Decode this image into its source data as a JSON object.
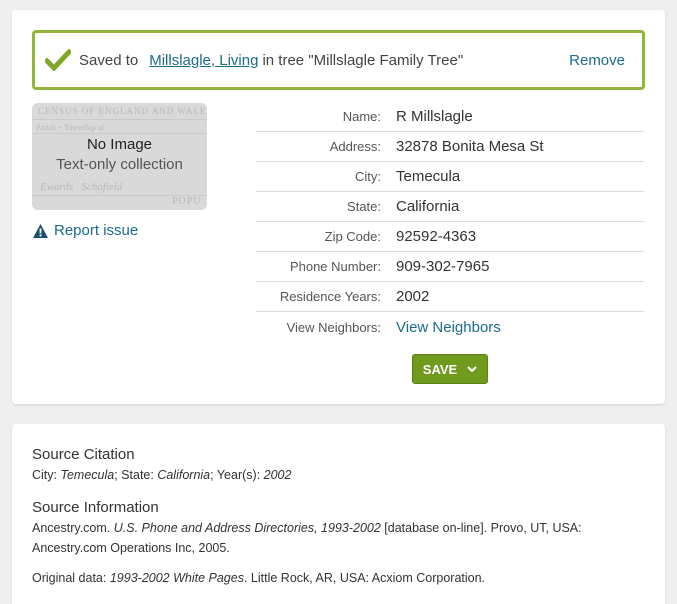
{
  "banner": {
    "saved_prefix": "Saved to",
    "person_link": "Millslagle, Living",
    "tree_text": "in tree \"Millslagle Family Tree\"",
    "remove_label": "Remove"
  },
  "image_panel": {
    "title": "No Image",
    "subtitle": "Text-only collection"
  },
  "report_label": "Report issue",
  "fields": [
    {
      "label": "Name:",
      "value": "R Millslagle"
    },
    {
      "label": "Address:",
      "value": "32878 Bonita Mesa St"
    },
    {
      "label": "City:",
      "value": "Temecula"
    },
    {
      "label": "State:",
      "value": "California"
    },
    {
      "label": "Zip Code:",
      "value": "92592-4363"
    },
    {
      "label": "Phone Number:",
      "value": "909-302-7965"
    },
    {
      "label": "Residence Years:",
      "value": "2002"
    },
    {
      "label": "View Neighbors:",
      "value": "View Neighbors"
    }
  ],
  "save_button": "SAVE",
  "source_citation": {
    "heading": "Source Citation",
    "city_label": "City:",
    "city": "Temecula",
    "state_label": "; State:",
    "state": "California",
    "years_label": "; Year(s):",
    "years": "2002"
  },
  "source_info": {
    "heading": "Source Information",
    "publisher": "Ancestry.com.",
    "db_title": "U.S. Phone and Address Directories, 1993-2002",
    "db_rest": "[database on-line]. Provo, UT, USA:",
    "line2": "Ancestry.com Operations Inc, 2005.",
    "orig_label": "Original data:",
    "orig_title": "1993-2002 White Pages",
    "orig_rest": ". Little Rock, AR, USA: Acxiom Corporation."
  },
  "colors": {
    "accent_green": "#94b43c",
    "link_blue": "#1c6b8a",
    "button_green": "#6f9a1d"
  },
  "icons": [
    "check-icon",
    "warning-icon",
    "chevron-down-icon"
  ]
}
